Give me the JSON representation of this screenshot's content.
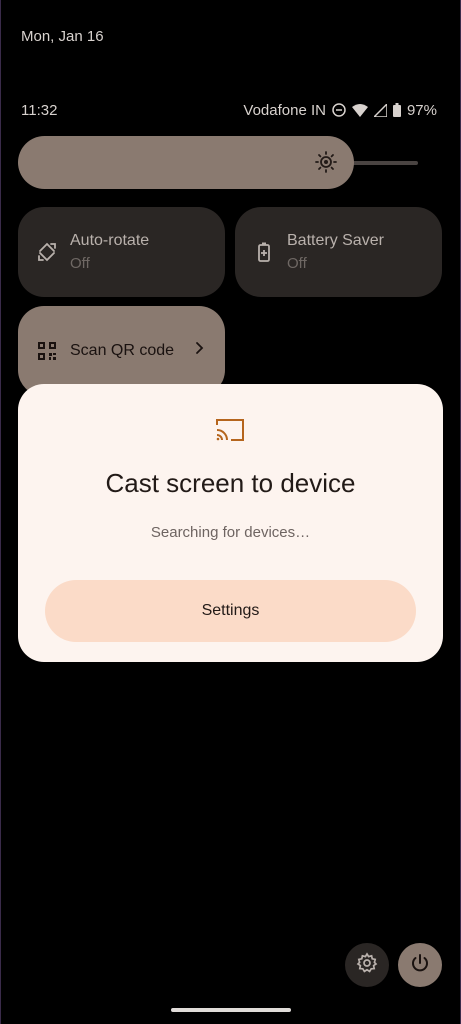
{
  "date": "Mon, Jan 16",
  "status": {
    "time": "11:32",
    "carrier": "Vodafone IN",
    "battery": "97%",
    "icons": [
      "dnd-icon",
      "wifi-icon",
      "signal-icon",
      "battery-icon"
    ]
  },
  "brightness": {
    "level_fraction": 0.84,
    "icon": "brightness-icon"
  },
  "tiles": [
    {
      "label": "Auto-rotate",
      "state": "Off",
      "icon": "auto-rotate-icon"
    },
    {
      "label": "Battery Saver",
      "state": "Off",
      "icon": "battery-saver-icon"
    },
    {
      "label": "Scan QR code",
      "icon": "qr-code-icon"
    }
  ],
  "dialog": {
    "icon": "cast-icon",
    "title": "Cast screen to device",
    "subtitle": "Searching for devices…",
    "button": "Settings"
  },
  "footer": {
    "settings_icon": "settings-icon",
    "power_icon": "power-icon"
  },
  "colors": {
    "accent": "#8a7a70",
    "dialog_bg": "#fdf4ef",
    "button_bg": "#fbdbc8",
    "cast_icon": "#b5651d"
  }
}
